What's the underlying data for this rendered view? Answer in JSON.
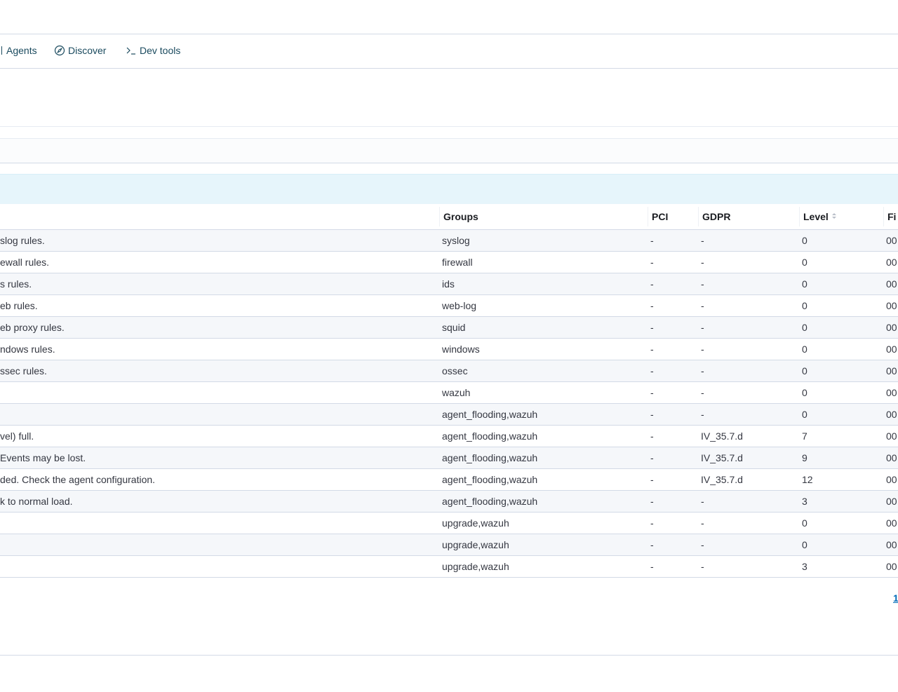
{
  "nav": {
    "tabs": [
      {
        "label": "Agents",
        "icon": "agents-icon"
      },
      {
        "label": "Discover",
        "icon": "compass-icon"
      },
      {
        "label": "Dev tools",
        "icon": "console-icon"
      }
    ]
  },
  "table": {
    "columns": [
      "Groups",
      "PCI",
      "GDPR",
      "Level",
      "Fi"
    ],
    "rows": [
      {
        "description": "slog rules.",
        "groups": "syslog",
        "pci": "-",
        "gdpr": "-",
        "level": "0",
        "file": "00"
      },
      {
        "description": "ewall rules.",
        "groups": "firewall",
        "pci": "-",
        "gdpr": "-",
        "level": "0",
        "file": "00"
      },
      {
        "description": "s rules.",
        "groups": "ids",
        "pci": "-",
        "gdpr": "-",
        "level": "0",
        "file": "00"
      },
      {
        "description": "eb rules.",
        "groups": "web-log",
        "pci": "-",
        "gdpr": "-",
        "level": "0",
        "file": "00"
      },
      {
        "description": "eb proxy rules.",
        "groups": "squid",
        "pci": "-",
        "gdpr": "-",
        "level": "0",
        "file": "00"
      },
      {
        "description": "ndows rules.",
        "groups": "windows",
        "pci": "-",
        "gdpr": "-",
        "level": "0",
        "file": "00"
      },
      {
        "description": "ssec rules.",
        "groups": "ossec",
        "pci": "-",
        "gdpr": "-",
        "level": "0",
        "file": "00"
      },
      {
        "description": "",
        "groups": "wazuh",
        "pci": "-",
        "gdpr": "-",
        "level": "0",
        "file": "00"
      },
      {
        "description": "",
        "groups": "agent_flooding,wazuh",
        "pci": "-",
        "gdpr": "-",
        "level": "0",
        "file": "00"
      },
      {
        "description": "vel) full.",
        "groups": "agent_flooding,wazuh",
        "pci": "-",
        "gdpr": "IV_35.7.d",
        "level": "7",
        "file": "00"
      },
      {
        "description": "Events may be lost.",
        "groups": "agent_flooding,wazuh",
        "pci": "-",
        "gdpr": "IV_35.7.d",
        "level": "9",
        "file": "00"
      },
      {
        "description": "ded. Check the agent configuration.",
        "groups": "agent_flooding,wazuh",
        "pci": "-",
        "gdpr": "IV_35.7.d",
        "level": "12",
        "file": "00"
      },
      {
        "description": "k to normal load.",
        "groups": "agent_flooding,wazuh",
        "pci": "-",
        "gdpr": "-",
        "level": "3",
        "file": "00"
      },
      {
        "description": "",
        "groups": "upgrade,wazuh",
        "pci": "-",
        "gdpr": "-",
        "level": "0",
        "file": "00"
      },
      {
        "description": "",
        "groups": "upgrade,wazuh",
        "pci": "-",
        "gdpr": "-",
        "level": "0",
        "file": "00"
      },
      {
        "description": "",
        "groups": "upgrade,wazuh",
        "pci": "-",
        "gdpr": "-",
        "level": "3",
        "file": "00"
      }
    ]
  },
  "pagination": {
    "current": "1"
  },
  "colors": {
    "accent": "#006bb8",
    "nav_text": "#1a4a5e",
    "callout_bg": "#e6f5fb"
  }
}
